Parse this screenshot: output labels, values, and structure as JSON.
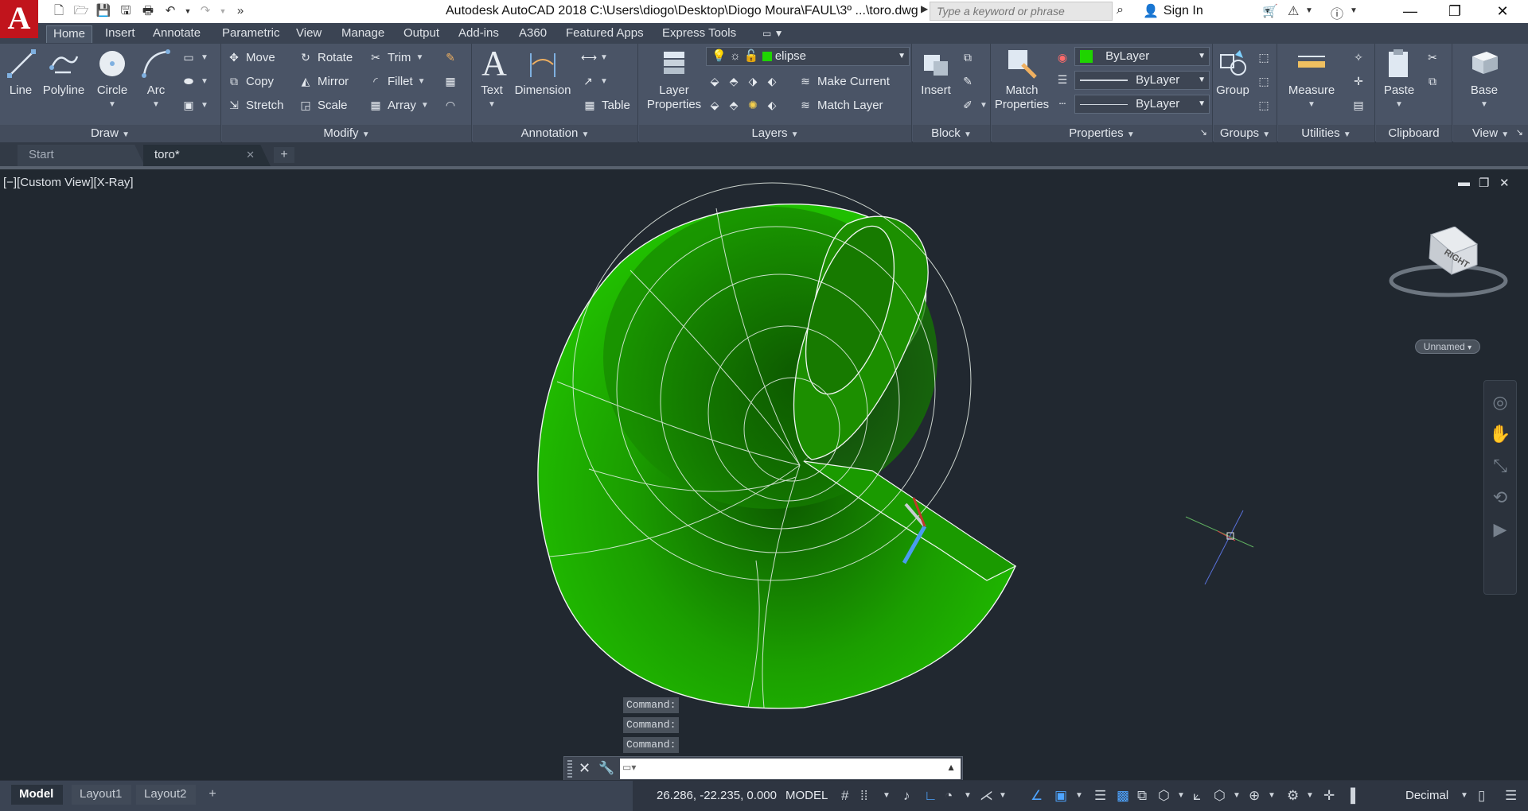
{
  "window": {
    "title": "Autodesk AutoCAD 2018     C:\\Users\\diogo\\Desktop\\Diogo Moura\\FAUL\\3º ...\\toro.dwg",
    "search_placeholder": "Type a keyword or phrase",
    "sign_in": "Sign In",
    "app_letter": "A"
  },
  "ribbon_tabs": [
    "Home",
    "Insert",
    "Annotate",
    "Parametric",
    "View",
    "Manage",
    "Output",
    "Add-ins",
    "A360",
    "Featured Apps",
    "Express Tools"
  ],
  "ribbon": {
    "draw": {
      "title": "Draw",
      "line": "Line",
      "polyline": "Polyline",
      "circle": "Circle",
      "arc": "Arc"
    },
    "modify": {
      "title": "Modify",
      "move": "Move",
      "rotate": "Rotate",
      "trim": "Trim",
      "copy": "Copy",
      "mirror": "Mirror",
      "fillet": "Fillet",
      "stretch": "Stretch",
      "scale": "Scale",
      "array": "Array"
    },
    "annotation": {
      "title": "Annotation",
      "text": "Text",
      "dimension": "Dimension",
      "table": "Table"
    },
    "layers": {
      "title": "Layers",
      "layer_properties_1": "Layer",
      "layer_properties_2": "Properties",
      "current_layer": "elipse",
      "make_current": "Make Current",
      "match_layer": "Match Layer"
    },
    "block": {
      "title": "Block",
      "insert": "Insert"
    },
    "properties": {
      "title": "Properties",
      "match_1": "Match",
      "match_2": "Properties",
      "color": "ByLayer",
      "linetype": "ByLayer",
      "lineweight": "ByLayer"
    },
    "groups": {
      "title": "Groups",
      "group": "Group"
    },
    "utilities": {
      "title": "Utilities",
      "measure": "Measure"
    },
    "clipboard": {
      "title": "Clipboard",
      "paste": "Paste"
    },
    "view": {
      "title": "View",
      "base": "Base"
    }
  },
  "doc_tabs": {
    "start": "Start",
    "active": "toro*"
  },
  "viewport": {
    "label": "[−][Custom View][X-Ray]",
    "unnamed": "Unnamed",
    "viewcube_face": "RIGHT"
  },
  "command": {
    "history": [
      "Command:",
      "Command:",
      "Command:"
    ],
    "input": ""
  },
  "statusbar": {
    "layouts": [
      "Model",
      "Layout1",
      "Layout2"
    ],
    "coords": "26.286, -22.235, 0.000",
    "model": "MODEL",
    "units": "Decimal"
  },
  "colors": {
    "accent_green": "#1fd400",
    "ribbon": "#4a5466",
    "viewport_bg": "#212830"
  }
}
